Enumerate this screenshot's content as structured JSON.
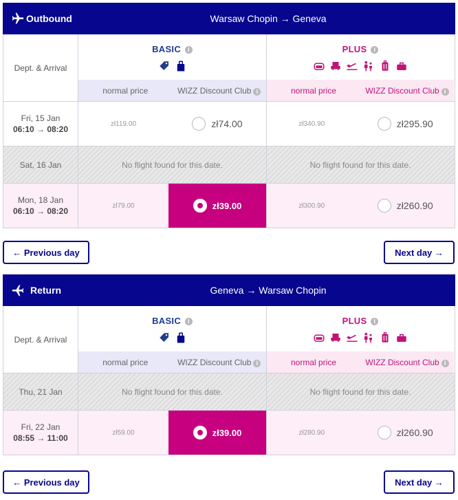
{
  "colors": {
    "header": "#06068f",
    "plus": "#c0137a",
    "selected": "#c6007e",
    "basic": "#1f3c8f"
  },
  "fares": {
    "basic": {
      "name": "BASIC",
      "info_icon": "info-icon",
      "icons": [
        "tag-icon",
        "bag-icon"
      ]
    },
    "plus": {
      "name": "PLUS",
      "info_icon": "info-icon",
      "icons": [
        "seat-icon",
        "armchair-icon",
        "plane-icon",
        "family-icon",
        "trolley-icon",
        "bag-icon"
      ]
    },
    "normal_price_label": "normal price",
    "club_label": "WIZZ Discount Club"
  },
  "dept_arrival_label": "Dept. & Arrival",
  "no_flight_text": "No flight found for this date.",
  "outbound": {
    "direction": "Outbound",
    "route": "Warsaw Chopin → Geneva",
    "rows": [
      {
        "date": "Fri, 15 Jan",
        "time": "06:10 → 08:20",
        "basic_normal": "zł119.00",
        "basic_club": "zł74.00",
        "plus_normal": "zł340.90",
        "plus_club": "zł295.90"
      },
      {
        "date": "Sat, 16 Jan"
      },
      {
        "date": "Mon, 18 Jan",
        "time": "06:10 → 08:20",
        "basic_normal": "zł79.00",
        "basic_club": "zł39.00",
        "plus_normal": "zł300.90",
        "plus_club": "zł260.90",
        "selected": "basic_club"
      }
    ],
    "prev_label": "← Previous day",
    "next_label": "Next day →"
  },
  "return": {
    "direction": "Return",
    "route": "Geneva → Warsaw Chopin",
    "rows": [
      {
        "date": "Thu, 21 Jan"
      },
      {
        "date": "Fri, 22 Jan",
        "time": "08:55 → 11:00",
        "basic_normal": "zł59.00",
        "basic_club": "zł39.00",
        "plus_normal": "zł280.90",
        "plus_club": "zł260.90",
        "selected": "basic_club"
      }
    ],
    "prev_label": "← Previous day",
    "next_label": "Next day →"
  }
}
